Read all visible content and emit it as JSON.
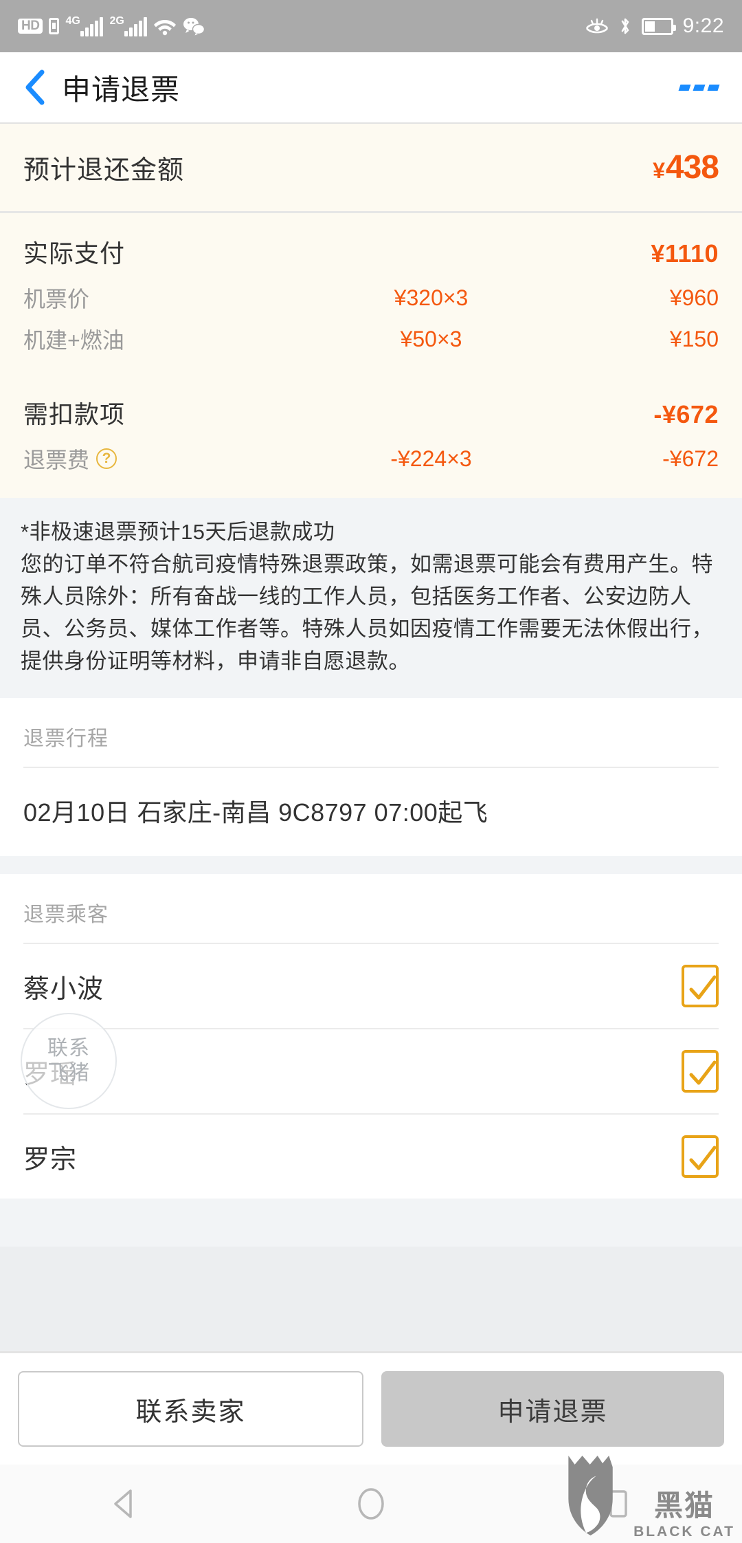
{
  "status_bar": {
    "hd_label": "HD",
    "net1_label": "4G",
    "net2_label": "2G",
    "time": "9:22",
    "icons": [
      "hd-badge-icon",
      "sim-card-icon",
      "signal-4g-icon",
      "signal-2g-icon",
      "wifi-icon",
      "wechat-icon",
      "eye-care-icon",
      "bluetooth-icon",
      "battery-icon"
    ]
  },
  "nav": {
    "back_icon": "back-chevron-icon",
    "title": "申请退票",
    "more_icon": "more-options-icon"
  },
  "refund_summary": {
    "label": "预计退还金额",
    "currency": "¥",
    "amount": "438"
  },
  "paid": {
    "title": "实际支付",
    "total": "¥1110",
    "items": [
      {
        "label": "机票价",
        "unit": "¥320×3",
        "subtotal": "¥960"
      },
      {
        "label": "机建+燃油",
        "unit": "¥50×3",
        "subtotal": "¥150"
      }
    ]
  },
  "deduction": {
    "title": "需扣款项",
    "total": "-¥672",
    "items": [
      {
        "label": "退票费",
        "help_icon": "?",
        "unit": "-¥224×3",
        "subtotal": "-¥672"
      }
    ]
  },
  "notice": {
    "line1": "*非极速退票预计15天后退款成功",
    "line2": "您的订单不符合航司疫情特殊退票政策，如需退票可能会有费用产生。特殊人员除外：所有奋战一线的工作人员，包括医务工作者、公安边防人员、公务员、媒体工作者等。特殊人员如因疫情工作需要无法休假出行，提供身份证明等材料，申请非自愿退款。"
  },
  "itinerary": {
    "section_title": "退票行程",
    "detail": "02月10日 石家庄-南昌 9C8797 07:00起飞"
  },
  "passengers": {
    "section_title": "退票乘客",
    "list": [
      {
        "name": "蔡小波",
        "checked": true
      },
      {
        "name": "罗瑶",
        "checked": true
      },
      {
        "name": "罗宗",
        "checked": true
      }
    ]
  },
  "floating_bubble": {
    "line1": "联系",
    "line2": "飞猪"
  },
  "footer": {
    "contact_seller": "联系卖家",
    "apply_refund": "申请退票"
  },
  "system_nav": {
    "back_icon": "nav-back-triangle-icon",
    "home_icon": "nav-home-circle-icon",
    "recents_icon": "nav-recents-square-icon"
  },
  "watermark": {
    "cn": "黑猫",
    "en": "BLACK CAT",
    "logo_icon": "black-cat-logo-icon"
  },
  "colors": {
    "accent_orange": "#f4580f",
    "checkbox_orange": "#e8a317",
    "link_blue": "#1a8cff",
    "panel_cream": "#fdfaf1",
    "page_grey": "#f2f4f6"
  }
}
